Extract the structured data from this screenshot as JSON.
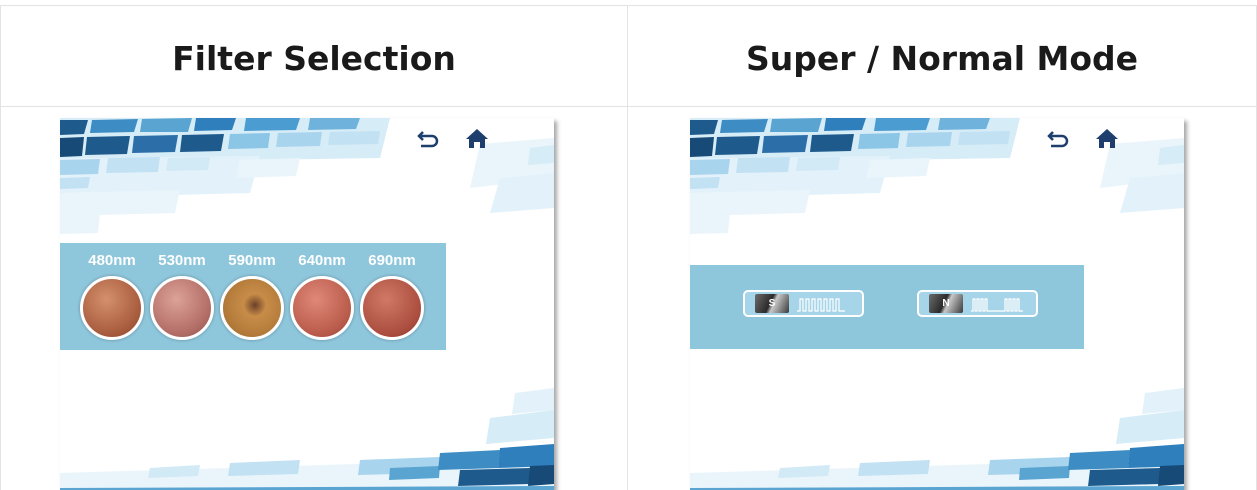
{
  "headers": {
    "left": "Filter Selection",
    "right": "Super / Normal Mode"
  },
  "left_screen": {
    "icons": [
      "back-icon",
      "home-icon"
    ],
    "filters": [
      {
        "label": "480nm",
        "color": "#b86a4a"
      },
      {
        "label": "530nm",
        "color": "#c07870"
      },
      {
        "label": "590nm",
        "color": "#b8803c"
      },
      {
        "label": "640nm",
        "color": "#c46a5c"
      },
      {
        "label": "690nm",
        "color": "#b85a4c"
      }
    ]
  },
  "right_screen": {
    "icons": [
      "back-icon",
      "home-icon"
    ],
    "modes": [
      {
        "badge": "S",
        "name": "super-mode"
      },
      {
        "badge": "N",
        "name": "normal-mode"
      }
    ]
  },
  "colors": {
    "panel": "#8ec6dc",
    "deco_dark": "#1e5a8c",
    "deco_mid": "#3d8dc4",
    "deco_light": "#bfe0f0"
  }
}
